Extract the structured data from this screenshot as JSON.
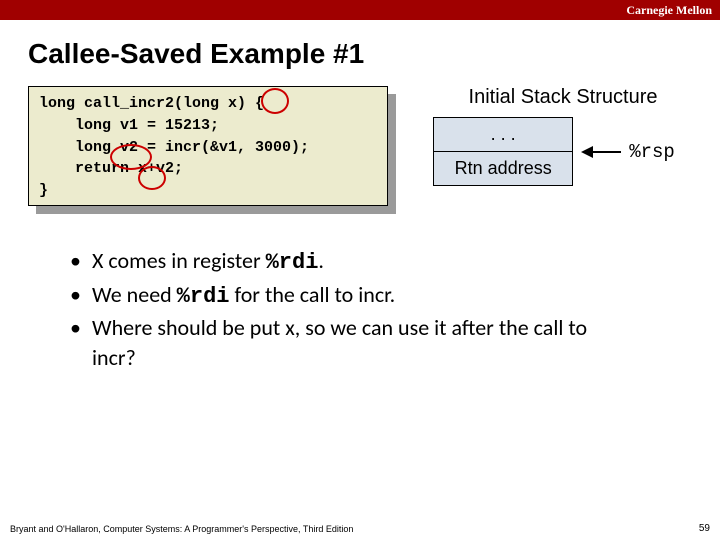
{
  "brand": "Carnegie Mellon",
  "title": "Callee-Saved Example #1",
  "code": {
    "l1": "long call_incr2(long x) {",
    "l2": "    long v1 = 15213;",
    "l3": "    long v2 = incr(&v1, 3000);",
    "l4": "    return x+v2;",
    "l5": "}"
  },
  "stack": {
    "heading": "Initial Stack Structure",
    "cell_top": ". . .",
    "cell_bot": "Rtn address",
    "pointer": "%rsp"
  },
  "bullets": {
    "b1a": "X comes in register ",
    "b1b": "%rdi",
    "b1c": ".",
    "b2a": "We need ",
    "b2b": "%rdi",
    "b2c": " for the call to incr.",
    "b3": "Where should be put x, so we can use it after the call to incr?"
  },
  "footer": "Bryant and O'Hallaron, Computer Systems: A Programmer's Perspective, Third Edition",
  "page": "59"
}
